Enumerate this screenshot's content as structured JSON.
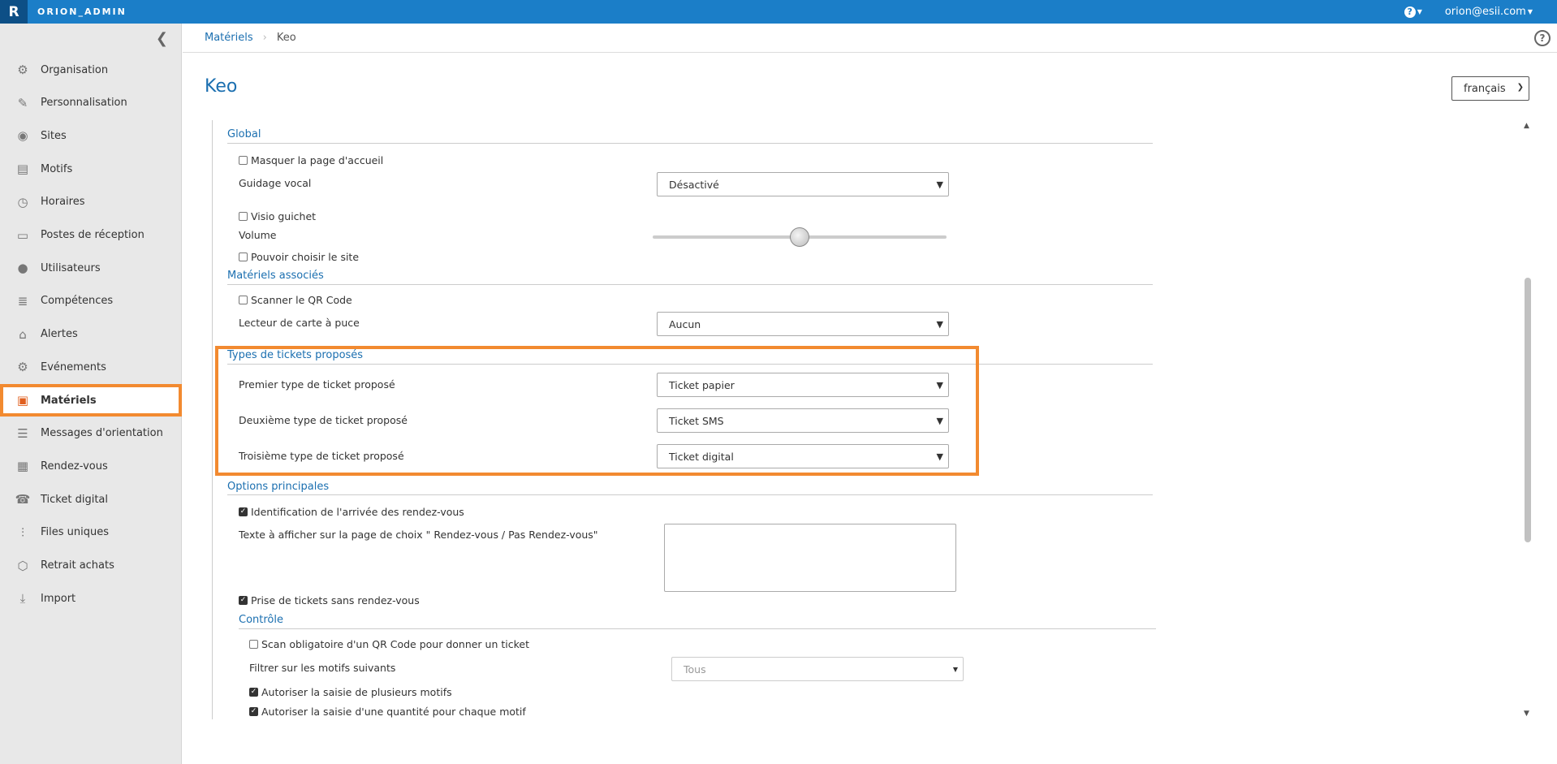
{
  "topbar": {
    "logo_letter": "R",
    "app_name": "ORION_ADMIN",
    "help_glyph": "?",
    "user": "orion@esii.com"
  },
  "sidebar": {
    "items": [
      {
        "label": "Organisation",
        "icon": "gear-icon"
      },
      {
        "label": "Personnalisation",
        "icon": "brush-icon"
      },
      {
        "label": "Sites",
        "icon": "map-pin-icon"
      },
      {
        "label": "Motifs",
        "icon": "clipboard-icon"
      },
      {
        "label": "Horaires",
        "icon": "clock-icon"
      },
      {
        "label": "Postes de réception",
        "icon": "laptop-icon"
      },
      {
        "label": "Utilisateurs",
        "icon": "user-icon"
      },
      {
        "label": "Compétences",
        "icon": "sliders-icon"
      },
      {
        "label": "Alertes",
        "icon": "bell-icon"
      },
      {
        "label": "Evénements",
        "icon": "gear-icon"
      },
      {
        "label": "Matériels",
        "icon": "kiosk-icon"
      },
      {
        "label": "Messages d'orientation",
        "icon": "signpost-icon"
      },
      {
        "label": "Rendez-vous",
        "icon": "calendar-icon"
      },
      {
        "label": "Ticket digital",
        "icon": "phone-icon"
      },
      {
        "label": "Files uniques",
        "icon": "queue-icon"
      },
      {
        "label": "Retrait achats",
        "icon": "package-icon"
      },
      {
        "label": "Import",
        "icon": "download-icon"
      }
    ],
    "active": "Matériels"
  },
  "breadcrumb": {
    "parent": "Matériels",
    "current": "Keo",
    "help_glyph": "?"
  },
  "page": {
    "title": "Keo",
    "language": "français"
  },
  "form": {
    "global": {
      "title": "Global",
      "hide_home": "Masquer la page d'accueil",
      "voice_label": "Guidage vocal",
      "voice_value": "Désactivé",
      "visio": "Visio guichet",
      "volume_label": "Volume",
      "volume_level": 0.5,
      "choose_site": "Pouvoir choisir le site"
    },
    "hardware": {
      "title": "Matériels associés",
      "qr_scan": "Scanner le QR Code",
      "card_reader_label": "Lecteur de carte à puce",
      "card_reader_value": "Aucun"
    },
    "tickets": {
      "title": "Types de tickets proposés",
      "first_label": "Premier type de ticket proposé",
      "first_value": "Ticket papier",
      "second_label": "Deuxième type de ticket proposé",
      "second_value": "Ticket SMS",
      "third_label": "Troisième type de ticket proposé",
      "third_value": "Ticket digital"
    },
    "options": {
      "title": "Options principales",
      "arrival_id": "Identification de l'arrivée des rendez-vous",
      "text_label": "Texte à afficher sur la page de choix \" Rendez-vous / Pas Rendez-vous\"",
      "text_value": "",
      "walk_in": "Prise de tickets sans rendez-vous"
    },
    "control": {
      "title": "Contrôle",
      "qr_required": "Scan obligatoire d'un QR Code pour donner un ticket",
      "filter_label": "Filtrer sur les motifs suivants",
      "filter_value": "Tous",
      "multi_motif": "Autoriser la saisie de plusieurs motifs",
      "quantity": "Autoriser la saisie d'une quantité pour chaque motif"
    }
  },
  "colors": {
    "topbar": "#1b7ec8",
    "accent": "#1b6fb0",
    "highlight": "#f28a30"
  }
}
